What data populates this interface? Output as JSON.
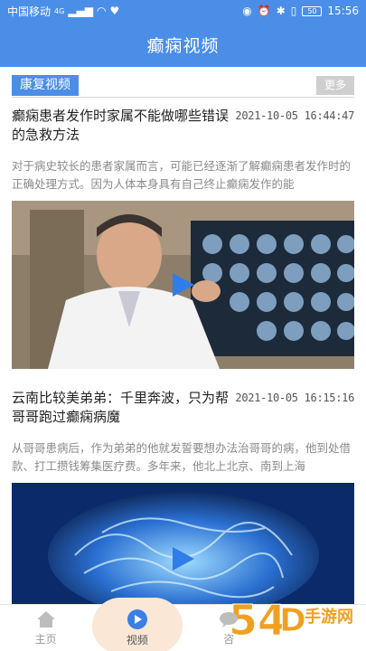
{
  "status_bar": {
    "carrier": "中国移动",
    "network": "4G",
    "battery": "50",
    "time": "15:56"
  },
  "app_bar": {
    "title": "癫痫视频"
  },
  "section": {
    "tag": "康复视频",
    "more": "更多"
  },
  "articles": [
    {
      "title": "癫痫患者发作时家属不能做哪些错误的急救方法",
      "time": "2021-10-05 16:44:47",
      "summary": "对于病史较长的患者家属而言，可能已经逐渐了解癫痫患者发作时的正确处理方式。因为人体本身具有自己终止癫痫发作的能"
    },
    {
      "title": "云南比较美弟弟：千里奔波，只为帮哥哥跑过癫痫病魔",
      "time": "2021-10-05 16:15:16",
      "summary": "从哥哥患病后，作为弟弟的他就发誓要想办法治哥哥的病，他到处借款、打工攒钱筹集医疗费。多年来，他北上北京、南到上海"
    }
  ],
  "bottom_nav": {
    "items": [
      {
        "label": "主页",
        "icon": "home-icon"
      },
      {
        "label": "视频",
        "icon": "play-icon"
      },
      {
        "label": "咨",
        "icon": "chat-icon"
      }
    ]
  },
  "watermark": {
    "text": "54D手游网"
  },
  "colors": {
    "primary": "#4a8ee8",
    "more_button": "#cfcfcf",
    "active_nav_bg": "#fbe7d6",
    "watermark": "#f0a020"
  }
}
